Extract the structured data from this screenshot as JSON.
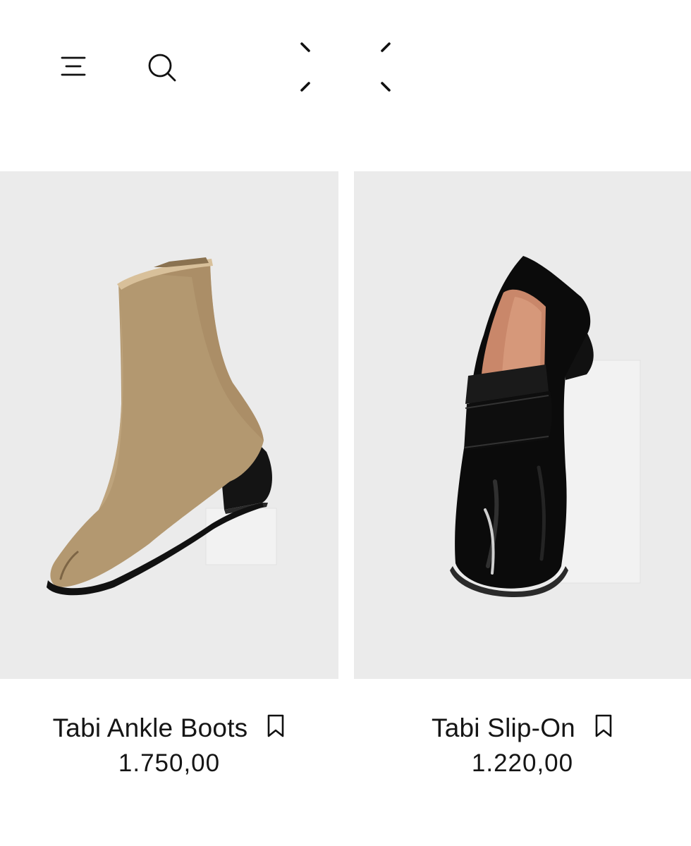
{
  "header": {
    "menu_icon": "menu-icon",
    "search_icon": "search-icon",
    "logo_icon": "brand-stitch-logo"
  },
  "products": [
    {
      "name": "Tabi Ankle Boots",
      "price": "1.750,00",
      "image": "tan-suede-tabi-ankle-boot",
      "bookmark_icon": "bookmark-icon",
      "color": "#b39870"
    },
    {
      "name": "Tabi Slip-On",
      "price": "1.220,00",
      "image": "black-leather-tabi-loafer",
      "bookmark_icon": "bookmark-icon",
      "color": "#0b0b0b"
    }
  ],
  "colors": {
    "background": "#ffffff",
    "card_background": "#ebebeb",
    "text": "#151515"
  }
}
